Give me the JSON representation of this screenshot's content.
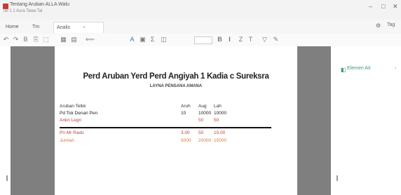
{
  "window": {
    "title": "Tentang Aruban ALLA Walu",
    "subtitle": "Tel 1 1 Aura Tawa Tal",
    "controls": [
      "–",
      "□",
      "✕"
    ]
  },
  "tabs": [
    {
      "label": "Home",
      "close": "",
      "active": false
    },
    {
      "label": "Tm",
      "close": "",
      "active": false
    },
    {
      "label": "Analis",
      "close": "×",
      "active": true
    }
  ],
  "tabbar_right": {
    "settings": "⚙",
    "user": "Tag"
  },
  "toolbar": {
    "icons": [
      {
        "name": "undo-icon",
        "glyph": "↶"
      },
      {
        "name": "redo-icon",
        "glyph": "↷"
      },
      {
        "name": "save-icon",
        "glyph": "B"
      },
      {
        "name": "copy-icon",
        "glyph": "⎘"
      },
      {
        "name": "paste-icon",
        "glyph": "⬚"
      },
      {
        "name": "grid-icon",
        "glyph": "▦"
      },
      {
        "name": "table-icon",
        "glyph": "▤"
      },
      {
        "name": "align-left-icon",
        "glyph": "⟸"
      },
      {
        "name": "text-icon",
        "glyph": "A"
      },
      {
        "name": "image-icon",
        "glyph": "▣"
      },
      {
        "name": "format-icon",
        "glyph": "Σ"
      },
      {
        "name": "bold-icon",
        "glyph": "B"
      },
      {
        "name": "italic-icon",
        "glyph": "I"
      },
      {
        "name": "underline-icon",
        "glyph": "Z"
      },
      {
        "name": "color-icon",
        "glyph": "T"
      },
      {
        "name": "filter-icon",
        "glyph": "▽"
      },
      {
        "name": "pen-icon",
        "glyph": "✎"
      }
    ]
  },
  "side_panel": {
    "label": "Elemen Ait",
    "icon": "◧",
    "chevron": "›"
  },
  "document": {
    "title": "Perd Aruban Yerd Perd Angiyah 1 Kadia c Sureksra",
    "subtitle": "LAYNA PENSANA AMANA",
    "header_row": [
      "Aruban Telkk",
      "Aruh",
      "Aug",
      "Lah"
    ],
    "rows": [
      {
        "cells": [
          "Pd Tok Denari Pen",
          "10",
          "10000",
          "10000"
        ],
        "style": "dark"
      },
      {
        "cells": [
          "Ankn Legn",
          "",
          "50",
          "50"
        ],
        "style": "red"
      },
      {
        "cells": [
          "Pn Mr Rado",
          "3.00",
          "50",
          "15.00"
        ],
        "style": "red"
      },
      {
        "cells": [
          "Jumlah",
          "5000",
          "20000",
          "15000"
        ],
        "style": "orange"
      }
    ]
  }
}
